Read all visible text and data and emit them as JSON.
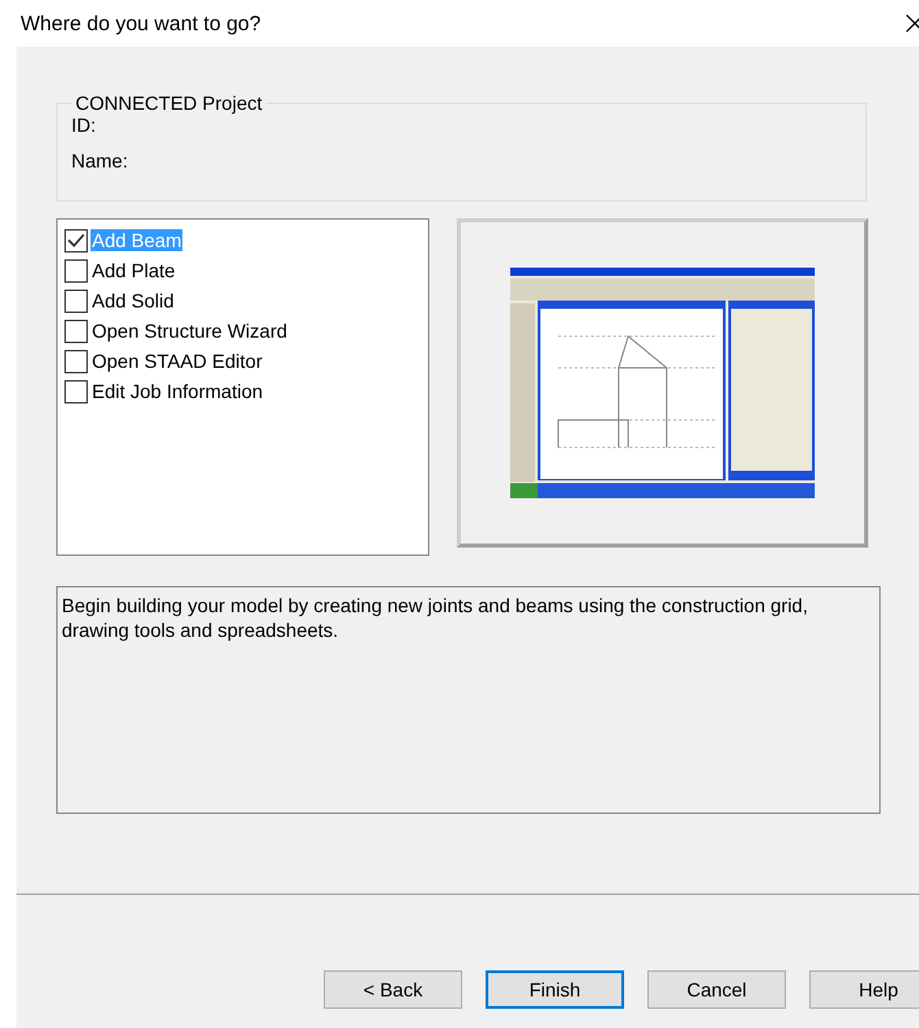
{
  "window": {
    "title": "Where do you want to go?"
  },
  "project": {
    "legend": "CONNECTED Project",
    "fields": [
      "ID:",
      "Name:"
    ]
  },
  "options": [
    {
      "label": "Add Beam",
      "checked": true,
      "selected": true
    },
    {
      "label": "Add Plate",
      "checked": false,
      "selected": false
    },
    {
      "label": "Add Solid",
      "checked": false,
      "selected": false
    },
    {
      "label": "Open Structure Wizard",
      "checked": false,
      "selected": false
    },
    {
      "label": "Open STAAD Editor",
      "checked": false,
      "selected": false
    },
    {
      "label": "Edit Job Information",
      "checked": false,
      "selected": false
    }
  ],
  "description": "Begin building your model by creating new joints and beams using the construction grid, drawing tools and spreadsheets.",
  "buttons": [
    {
      "label": "< Back",
      "focused": false
    },
    {
      "label": "Finish",
      "focused": true
    },
    {
      "label": "Cancel",
      "focused": false
    },
    {
      "label": "Help",
      "focused": false
    }
  ]
}
